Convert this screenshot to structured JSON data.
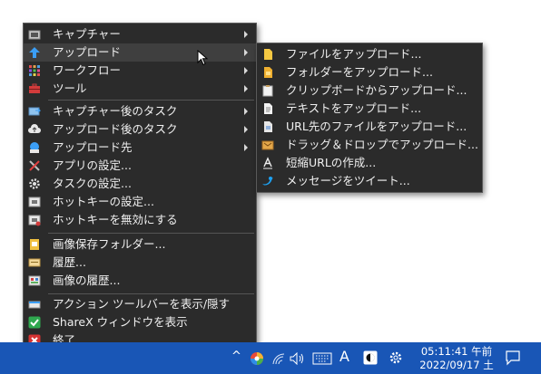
{
  "main_menu": {
    "items": [
      {
        "label": "キャプチャー",
        "icon": "camera-icon",
        "submenu": true
      },
      {
        "label": "アップロード",
        "icon": "upload-arrow-icon",
        "submenu": true,
        "highlighted": true
      },
      {
        "label": "ワークフロー",
        "icon": "workflow-grid-icon",
        "submenu": true
      },
      {
        "label": "ツール",
        "icon": "toolbox-icon",
        "submenu": true
      },
      {
        "label": "キャプチャー後のタスク",
        "icon": "image-arrow-icon",
        "submenu": true
      },
      {
        "label": "アップロード後のタスク",
        "icon": "cloud-upload-icon",
        "submenu": true
      },
      {
        "label": "アップロード先",
        "icon": "destination-icon",
        "submenu": true
      },
      {
        "label": "アプリの設定...",
        "icon": "wrench-screwdriver-icon",
        "submenu": false
      },
      {
        "label": "タスクの設定...",
        "icon": "gear-icon",
        "submenu": false
      },
      {
        "label": "ホットキーの設定...",
        "icon": "keyboard-icon",
        "submenu": false
      },
      {
        "label": "ホットキーを無効にする",
        "icon": "keyboard-disabled-icon",
        "submenu": false
      },
      {
        "label": "画像保存フォルダー...",
        "icon": "folder-image-icon",
        "submenu": false
      },
      {
        "label": "履歴...",
        "icon": "history-icon",
        "submenu": false
      },
      {
        "label": "画像の履歴...",
        "icon": "image-history-icon",
        "submenu": false
      },
      {
        "label": "アクション ツールバーを表示/隠す",
        "icon": "toolbar-icon",
        "submenu": false
      },
      {
        "label": "ShareX ウィンドウを表示",
        "icon": "checkmark-icon",
        "submenu": false
      },
      {
        "label": "終了",
        "icon": "close-icon",
        "submenu": false
      }
    ]
  },
  "upload_submenu": {
    "items": [
      {
        "label": "ファイルをアップロード...",
        "icon": "file-icon"
      },
      {
        "label": "フォルダーをアップロード...",
        "icon": "folder-icon"
      },
      {
        "label": "クリップボードからアップロード...",
        "icon": "clipboard-icon"
      },
      {
        "label": "テキストをアップロード...",
        "icon": "text-file-icon"
      },
      {
        "label": "URL先のファイルをアップロード...",
        "icon": "url-file-icon"
      },
      {
        "label": "ドラッグ＆ドロップでアップロード...",
        "icon": "drag-drop-icon"
      },
      {
        "label": "短縮URLの作成...",
        "icon": "shorten-url-icon"
      },
      {
        "label": "メッセージをツイート...",
        "icon": "twitter-icon"
      }
    ]
  },
  "taskbar": {
    "chevron": "^",
    "ime_mode": "A",
    "clock_time": "05:11:41 午前",
    "clock_date": "2022/09/17 土"
  },
  "colors": {
    "menu_bg": "#2b2b2b",
    "highlight": "#3f3f3f",
    "taskbar": "#1956b6"
  }
}
